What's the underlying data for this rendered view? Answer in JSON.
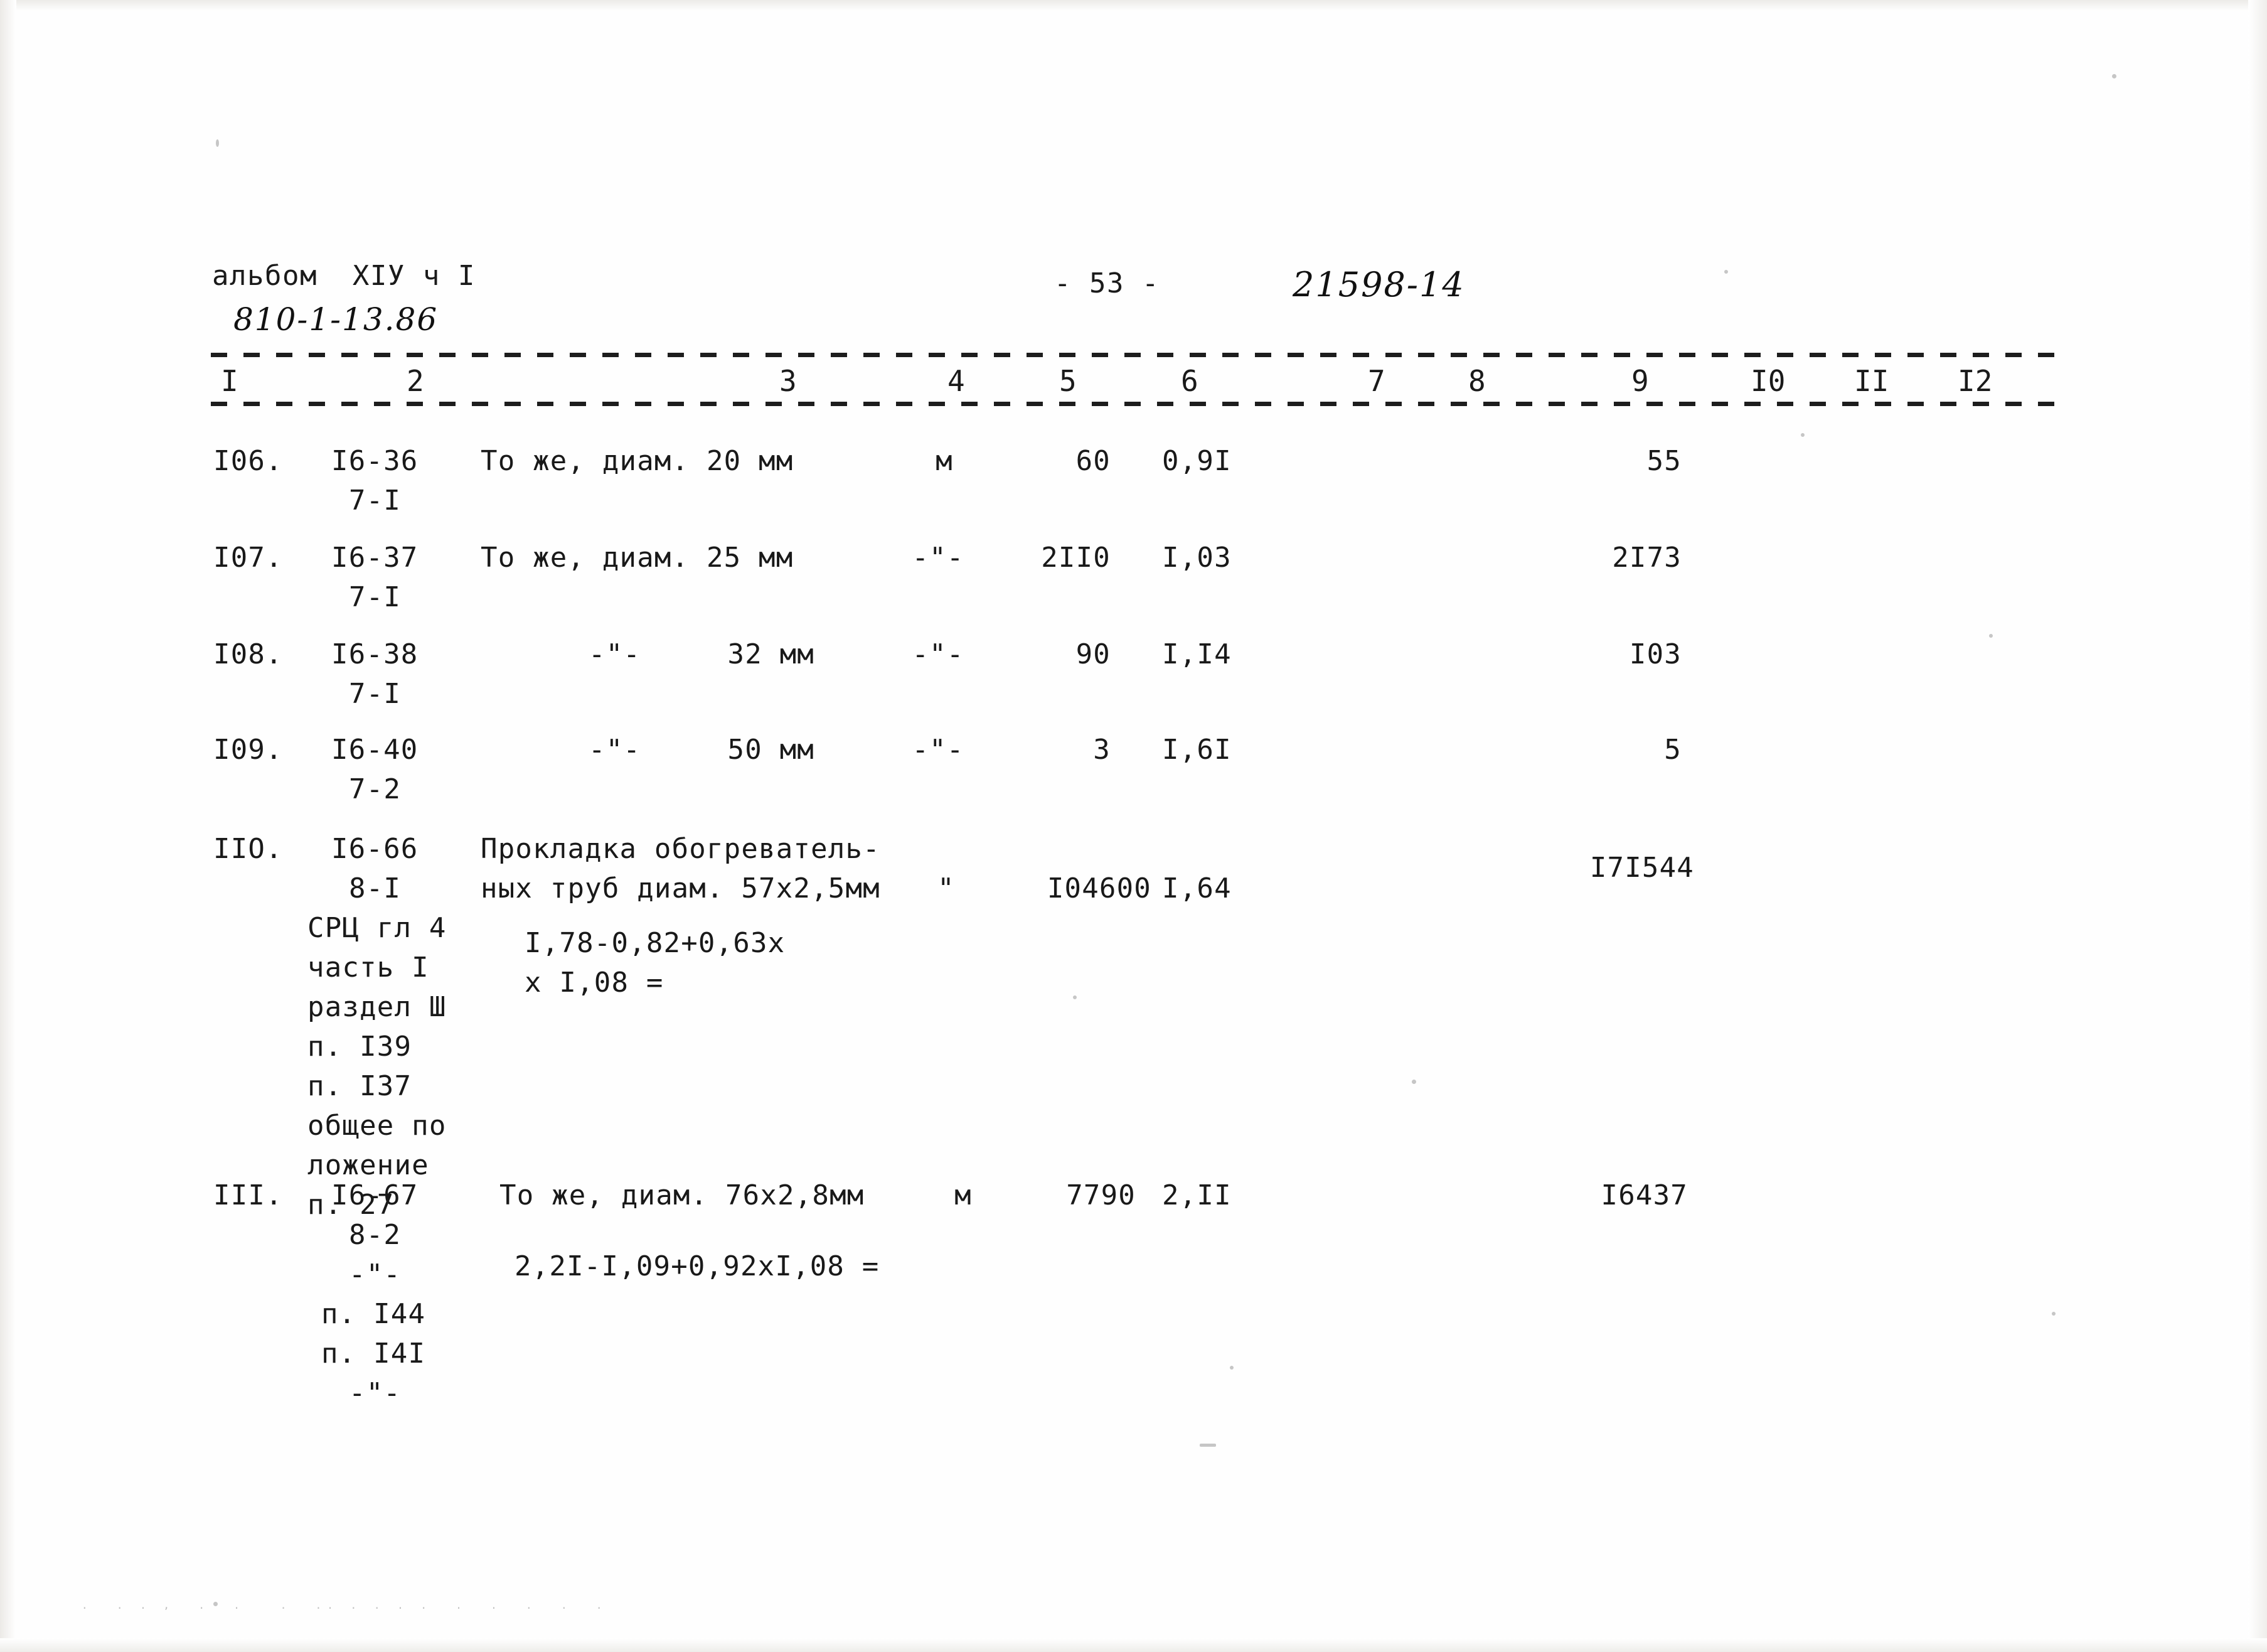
{
  "document": {
    "album_line": "альбом  ХIУ ч I",
    "album_code_handwritten": "810-1-13.86",
    "page_number": "- 53 -",
    "doc_number_handwritten": "21598-14"
  },
  "table": {
    "column_numbers": [
      "I",
      "2",
      "3",
      "4",
      "5",
      "6",
      "7",
      "8",
      "9",
      "I0",
      "II",
      "I2"
    ],
    "rows": [
      {
        "num": "I06.",
        "code": "I6-36",
        "code2": "7-I",
        "name": "То же, диам. 20 мм",
        "unit": "м",
        "qty": "60",
        "price": "0,9I",
        "total": "55",
        "extra_refs": [],
        "formula": []
      },
      {
        "num": "I07.",
        "code": "I6-37",
        "code2": "7-I",
        "name": "То же, диам. 25 мм",
        "unit": "-\"-",
        "qty": "2II0",
        "price": "I,03",
        "total": "2I73",
        "extra_refs": [],
        "formula": []
      },
      {
        "num": "I08.",
        "code": "I6-38",
        "code2": "7-I",
        "name": "-\"-     32 мм",
        "unit": "-\"-",
        "qty": "90",
        "price": "I,I4",
        "total": "I03",
        "extra_refs": [],
        "formula": []
      },
      {
        "num": "I09.",
        "code": "I6-40",
        "code2": "7-2",
        "name": "-\"-     50 мм",
        "unit": "-\"-",
        "qty": "3",
        "price": "I,6I",
        "total": "5",
        "extra_refs": [],
        "formula": []
      },
      {
        "num": "IIO.",
        "code": "I6-66",
        "code2": "8-I",
        "name": "Прокладка обогреватель-",
        "name_line2": "ных труб диам. 57х2,5мм",
        "unit": "\"",
        "qty": "I04600",
        "price": "I,64",
        "total": "I7I544",
        "extra_refs": [
          "СРЦ гл 4",
          "часть I",
          "раздел Ш",
          "п. I39",
          "п. I37",
          "общее по",
          "ложение",
          "п. 27"
        ],
        "formula": [
          "I,78-0,82+0,63х",
          "х I,08 ="
        ]
      },
      {
        "num": "III.",
        "code": "I6-67",
        "code2": "8-2",
        "name": "То же, диам. 76х2,8мм",
        "unit": "м",
        "qty": "7790",
        "price": "2,II",
        "total": "I6437",
        "extra_refs": [
          "-\"-",
          "п. I44",
          "п. I4I",
          "-\"-"
        ],
        "formula": [
          "2,2I-I,09+0,92хI,08 ="
        ]
      }
    ]
  },
  "colors": {
    "ink": "#191919",
    "paper": "#fefefe",
    "scan_edge": "#ecebe8"
  }
}
